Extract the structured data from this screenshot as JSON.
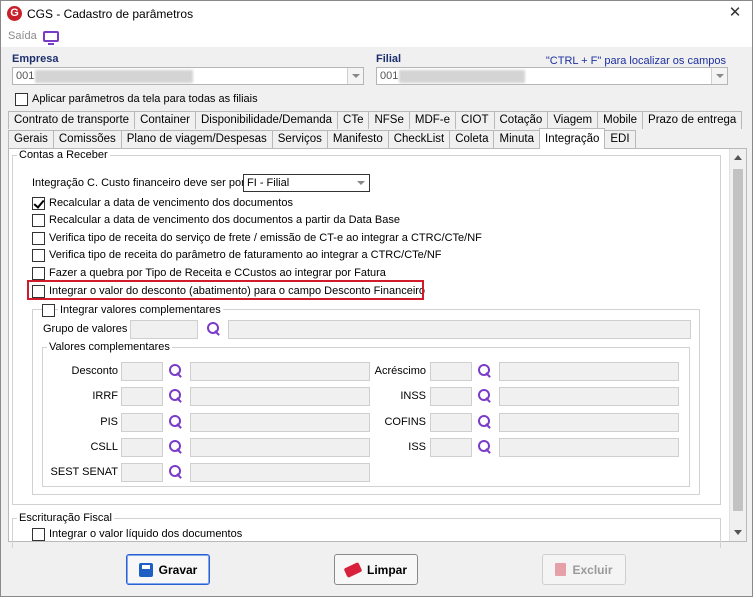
{
  "window": {
    "app_logo": "G",
    "title": "CGS - Cadastro de parâmetros",
    "close": "✕"
  },
  "menu": {
    "saida": "Saída",
    "monitor_icon": "monitor-icon"
  },
  "header": {
    "empresa_label": "Empresa",
    "empresa_value": "001",
    "filial_label": "Filial",
    "filial_value": "001",
    "hint": "\"CTRL + F\" para localizar os campos",
    "apply_all_label": "Aplicar parâmetros da tela para todas as filiais"
  },
  "tabs_row1": [
    "Contrato de transporte",
    "Container",
    "Disponibilidade/Demanda",
    "CTe",
    "NFSe",
    "MDF-e",
    "CIOT",
    "Cotação",
    "Viagem",
    "Mobile",
    "Prazo de entrega"
  ],
  "tabs_row2": [
    "Gerais",
    "Comissões",
    "Plano de viagem/Despesas",
    "Serviços",
    "Manifesto",
    "CheckList",
    "Coleta",
    "Minuta",
    "Integração",
    "EDI"
  ],
  "active_tab": "Integração",
  "contas_receber": {
    "title": "Contas a Receber",
    "custo_label": "Integração C. Custo financeiro deve ser por",
    "custo_value": "FI   - Filial",
    "options": [
      {
        "label": "Recalcular a data de vencimento dos documentos",
        "checked": true
      },
      {
        "label": "Recalcular a data de vencimento dos documentos a partir da Data Base",
        "checked": false
      },
      {
        "label": "Verifica tipo de receita do serviço de frete / emissão de CT-e ao integrar a CTRC/CTe/NF",
        "checked": false
      },
      {
        "label": "Verifica tipo de receita do parâmetro de faturamento ao integrar a CTRC/CTe/NF",
        "checked": false
      },
      {
        "label": "Fazer a quebra por Tipo de Receita e CCustos ao integrar por Fatura",
        "checked": false
      },
      {
        "label": "Integrar o valor do desconto (abatimento) para o campo Desconto Financeiro",
        "checked": false
      }
    ],
    "complementares": {
      "title": "Integrar valores complementares",
      "grupo_label": "Grupo de valores",
      "valores_title": "Valores complementares",
      "left_fields": [
        "Desconto",
        "IRRF",
        "PIS",
        "CSLL",
        "SEST SENAT"
      ],
      "right_fields": [
        "Acréscimo",
        "INSS",
        "COFINS",
        "ISS"
      ]
    }
  },
  "escrituracao": {
    "title": "Escrituração Fiscal",
    "option": "Integrar o valor líquido dos documentos"
  },
  "buttons": {
    "gravar": "Gravar",
    "limpar": "Limpar",
    "excluir": "Excluir"
  }
}
